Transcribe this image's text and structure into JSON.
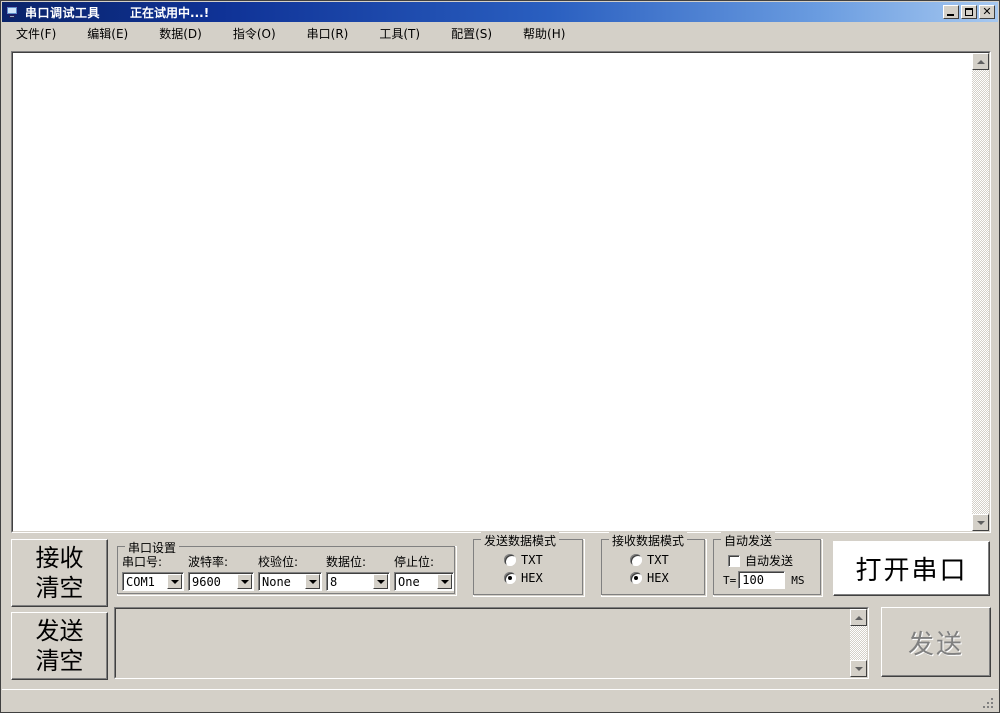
{
  "window": {
    "title": "串口调试工具",
    "subtitle": "正在试用中...!",
    "icon": "monitor-icon",
    "buttons": {
      "minimize": "_",
      "maximize": "□",
      "close": "✕"
    }
  },
  "menu": {
    "items": [
      {
        "label": "文件(F)"
      },
      {
        "label": "编辑(E)"
      },
      {
        "label": "数据(D)"
      },
      {
        "label": "指令(O)"
      },
      {
        "label": "串口(R)"
      },
      {
        "label": "工具(T)"
      },
      {
        "label": "配置(S)"
      },
      {
        "label": "帮助(H)"
      }
    ]
  },
  "receive_area": {
    "text": "",
    "scrollbar": {
      "up": "▲",
      "down": "▼"
    }
  },
  "buttons": {
    "clear_receive": {
      "line1": "接收",
      "line2": "清空"
    },
    "clear_send": {
      "line1": "发送",
      "line2": "清空"
    },
    "open_port": "打开串口",
    "send": "发送",
    "send_enabled": false
  },
  "serial_settings": {
    "title": "串口设置",
    "fields": [
      {
        "label": "串口号:",
        "value": "COM1"
      },
      {
        "label": "波特率:",
        "value": "9600"
      },
      {
        "label": "校验位:",
        "value": "None"
      },
      {
        "label": "数据位:",
        "value": "8"
      },
      {
        "label": "停止位:",
        "value": "One"
      }
    ]
  },
  "send_mode": {
    "title": "发送数据模式",
    "options": [
      {
        "label": "TXT",
        "selected": false
      },
      {
        "label": "HEX",
        "selected": true
      }
    ]
  },
  "receive_mode": {
    "title": "接收数据模式",
    "options": [
      {
        "label": "TXT",
        "selected": false
      },
      {
        "label": "HEX",
        "selected": true
      }
    ]
  },
  "auto_send": {
    "title": "自动发送",
    "checkbox_label": "自动发送",
    "checked": false,
    "interval_prefix": "T=",
    "interval_value": "100",
    "interval_unit": "MS"
  },
  "send_area": {
    "text": ""
  },
  "status_bar": {
    "text": ""
  },
  "colors": {
    "face": "#d4d0c8",
    "title_start": "#0a246a",
    "title_end": "#a6c8f0",
    "text": "#000000",
    "disabled_text": "#808080"
  }
}
